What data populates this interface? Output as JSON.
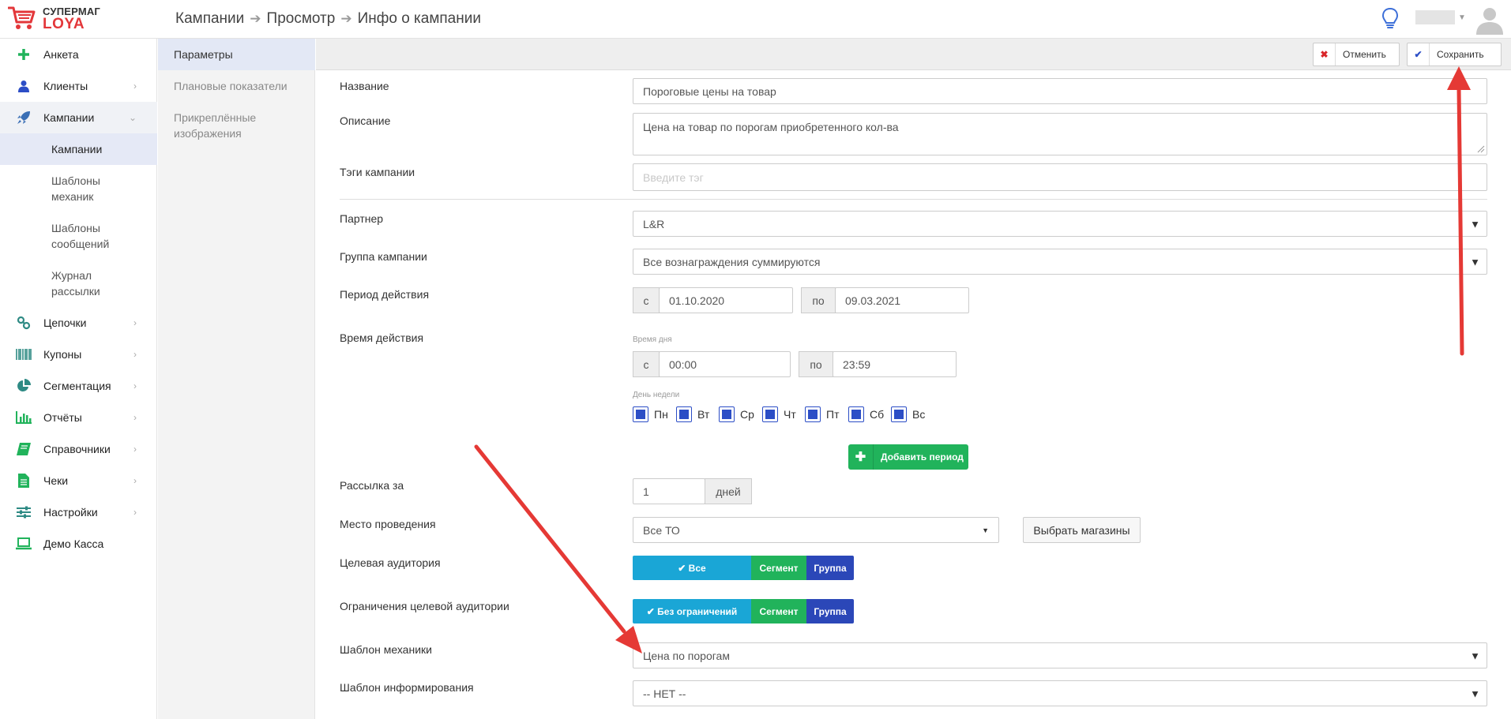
{
  "header": {
    "logo_line1": "СУПЕРМАГ",
    "logo_line2": "LOYA",
    "breadcrumbs": [
      "Кампании",
      "Просмотр",
      "Инфо о кампании"
    ]
  },
  "sidebar": {
    "items": [
      {
        "label": "Анкета",
        "icon": "plus-icon"
      },
      {
        "label": "Клиенты",
        "icon": "user-icon"
      },
      {
        "label": "Кампании",
        "icon": "rocket-icon"
      },
      {
        "label": "Цепочки",
        "icon": "link-icon"
      },
      {
        "label": "Купоны",
        "icon": "barcode-icon"
      },
      {
        "label": "Сегментация",
        "icon": "pie-chart-icon"
      },
      {
        "label": "Отчёты",
        "icon": "bar-chart-icon"
      },
      {
        "label": "Справочники",
        "icon": "book-icon"
      },
      {
        "label": "Чеки",
        "icon": "document-icon"
      },
      {
        "label": "Настройки",
        "icon": "sliders-icon"
      },
      {
        "label": "Демо Касса",
        "icon": "laptop-icon"
      }
    ],
    "subitems": [
      {
        "label": "Кампании"
      },
      {
        "label": "Шаблоны механик"
      },
      {
        "label": "Шаблоны сообщений"
      },
      {
        "label": "Журнал рассылки"
      }
    ]
  },
  "subbar": {
    "items": [
      {
        "label": "Параметры"
      },
      {
        "label": "Плановые показатели"
      },
      {
        "label": "Прикреплённые изображения"
      }
    ]
  },
  "toolbar": {
    "cancel_label": "Отменить",
    "save_label": "Сохранить"
  },
  "form": {
    "name_label": "Название",
    "name_value": "Пороговые цены на товар",
    "description_label": "Описание",
    "description_value": "Цена на товар по порогам приобретенного кол-ва",
    "tags_label": "Тэги кампании",
    "tags_placeholder": "Введите тэг",
    "partner_label": "Партнер",
    "partner_value": "L&R",
    "group_label": "Группа кампании",
    "group_value": "Все вознаграждения суммируются",
    "period_label": "Период действия",
    "period_from_prefix": "с",
    "period_from": "01.10.2020",
    "period_to_prefix": "по",
    "period_to": "09.03.2021",
    "time_label": "Время действия",
    "time_hint": "Время дня",
    "time_from_prefix": "с",
    "time_from": "00:00",
    "time_to_prefix": "по",
    "time_to": "23:59",
    "weekday_hint": "День недели",
    "weekdays": [
      "Пн",
      "Вт",
      "Ср",
      "Чт",
      "Пт",
      "Сб",
      "Вс"
    ],
    "add_period_label": "Добавить период",
    "mailing_label": "Рассылка за",
    "mailing_value": "1",
    "mailing_unit": "дней",
    "place_label": "Место проведения",
    "place_value": "Все ТО",
    "choose_stores_label": "Выбрать магазины",
    "audience_label": "Целевая аудитория",
    "audience_options": [
      "✔ Все",
      "Сегмент",
      "Группа"
    ],
    "restrictions_label": "Ограничения целевой аудитории",
    "restrictions_options": [
      "✔ Без ограничений",
      "Сегмент",
      "Группа"
    ],
    "mechanic_label": "Шаблон механики",
    "mechanic_value": "Цена по порогам",
    "info_label": "Шаблон информирования",
    "info_value": "-- НЕТ --"
  },
  "colors": {
    "accent_blue": "#2c4ec6",
    "cyan": "#1aa6d6",
    "green": "#21b35b",
    "navy": "#2b47b8",
    "brand_red": "#e3373a",
    "annotation_red": "#e53935"
  }
}
